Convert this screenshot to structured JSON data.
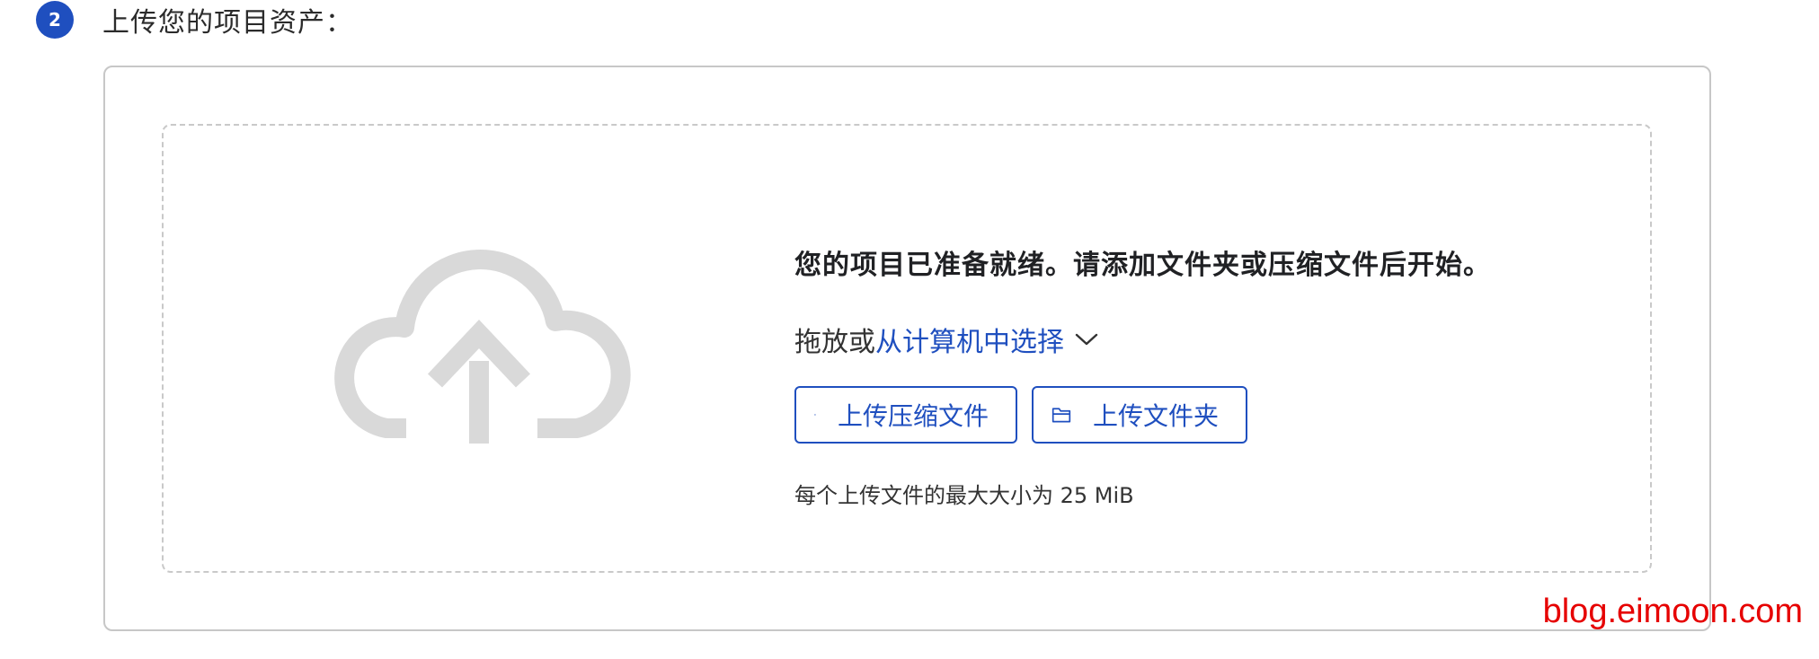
{
  "step": {
    "number": "2",
    "title": "上传您的项目资产："
  },
  "drop_zone": {
    "ready_text": "您的项目已准备就绪。请添加文件夹或压缩文件后开始。",
    "choose_prefix": "拖放或",
    "choose_link": "从计算机中选择",
    "buttons": {
      "upload_zip": "上传压缩文件",
      "upload_folder": "上传文件夹"
    },
    "size_note": "每个上传文件的最大大小为 25 MiB"
  },
  "watermark": "blog.eimoon.com",
  "colors": {
    "accent": "#1f4fbf",
    "cloud": "#d9d9d9",
    "watermark": "#e60000"
  },
  "icons": {
    "step_badge": "step-number-badge",
    "cloud": "cloud-upload-icon",
    "chevron": "chevron-down-icon",
    "zip": "document-icon",
    "folder": "folder-icon"
  }
}
